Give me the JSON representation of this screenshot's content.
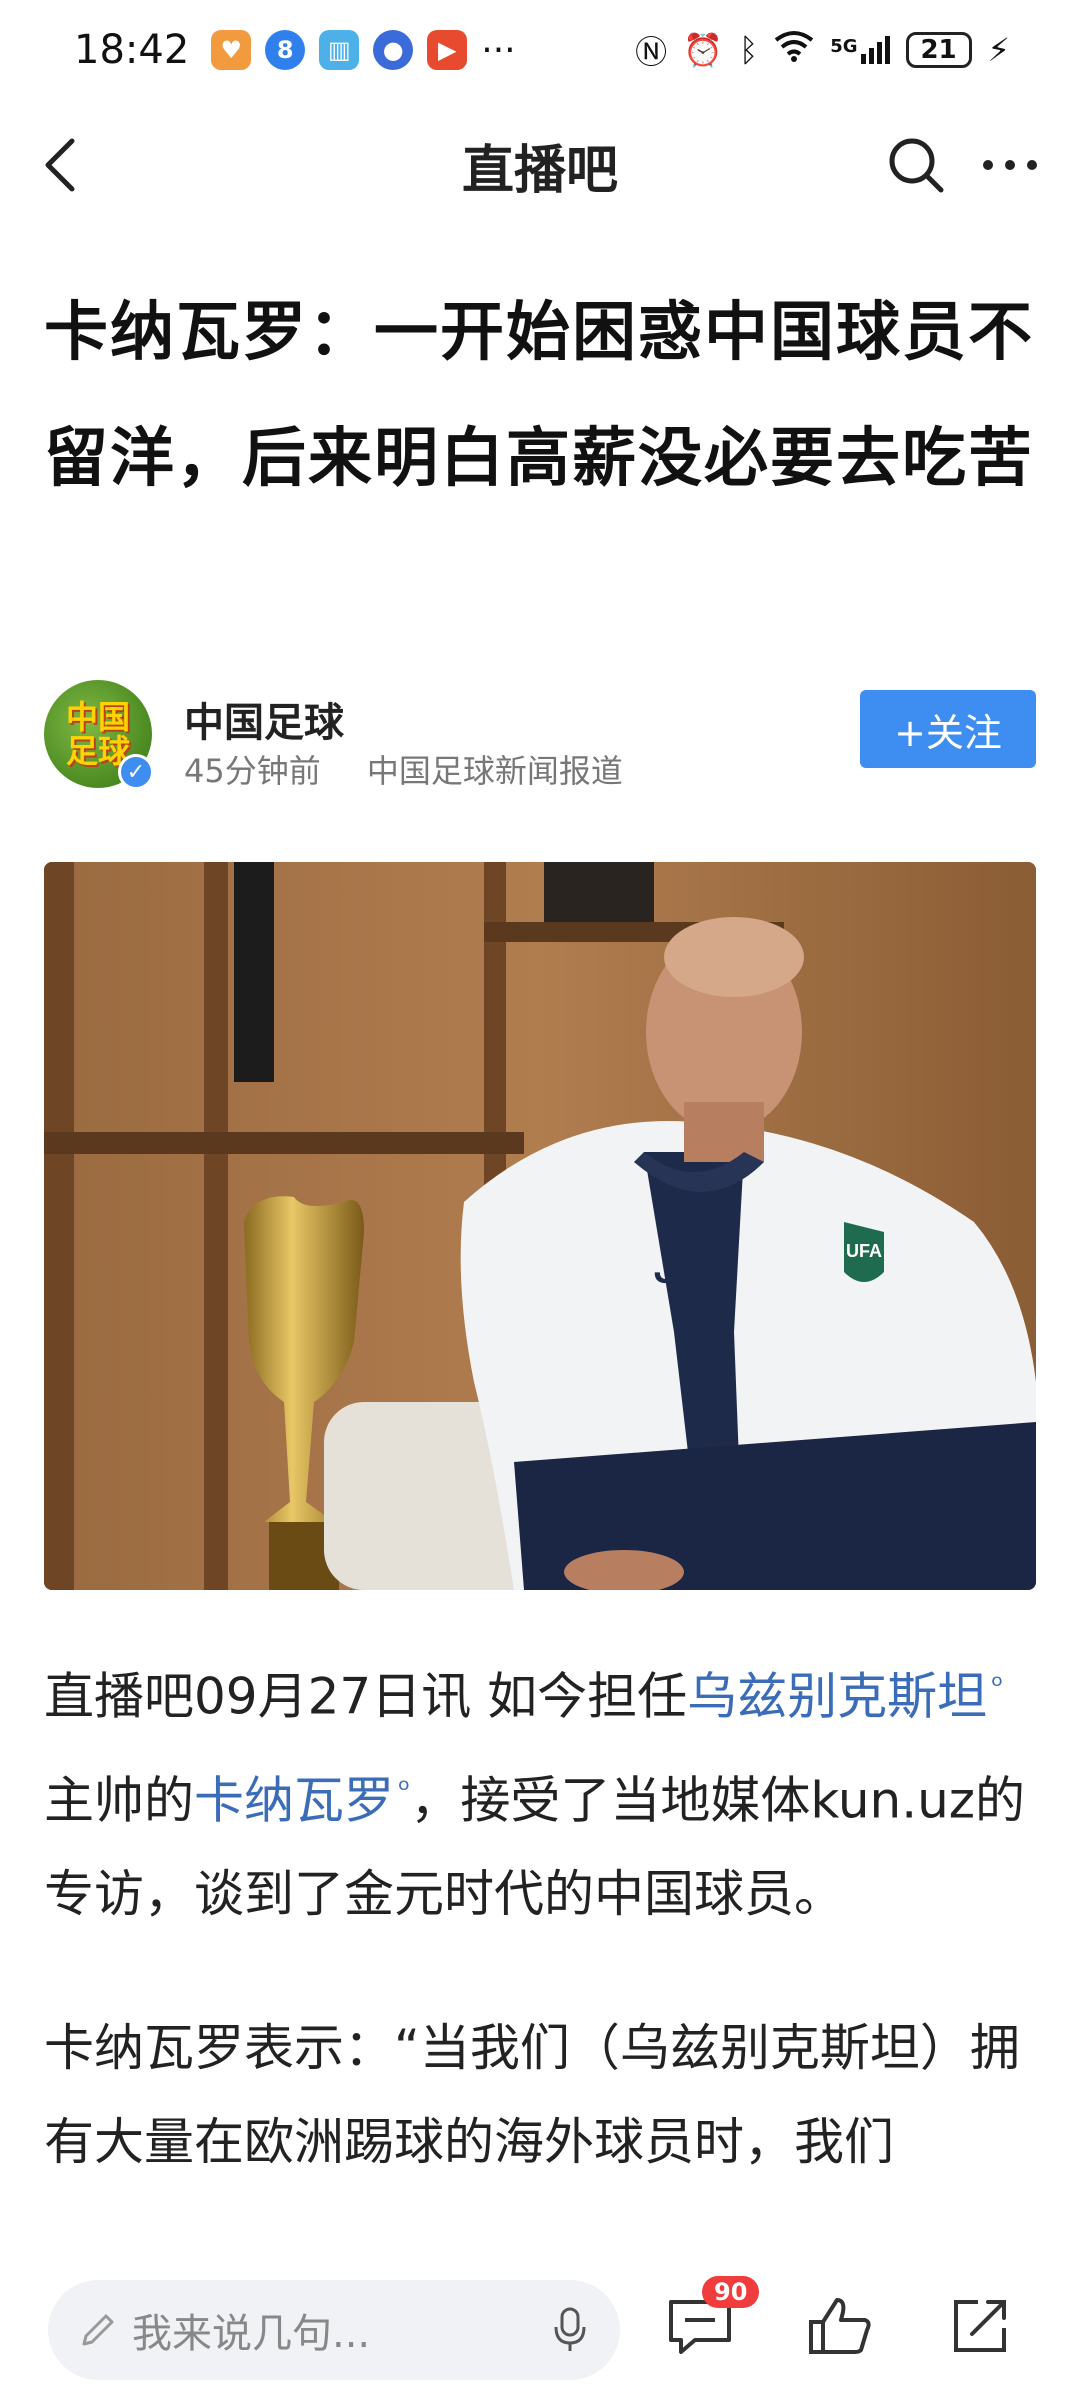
{
  "status_bar": {
    "time": "18:42",
    "battery": "21",
    "network": "5G",
    "more": "···"
  },
  "nav": {
    "title": "直播吧"
  },
  "article": {
    "headline": "卡纳瓦罗：一开始困惑中国球员不留洋，后来明白高薪没必要去吃苦",
    "author_name": "中国足球",
    "time_ago": "45分钟前",
    "source": "中国足球新闻报道",
    "follow_label": "+关注",
    "avatar_text": "中国足球",
    "p1_prefix": "直播吧09月27日讯 如今担任",
    "p1_link1": "乌兹别克斯坦",
    "p1_mid": " 主帅的",
    "p1_link2": "卡纳瓦罗",
    "p1_suffix": "，接受了当地媒体kun.uz的专访，谈到了金元时代的中国球员。",
    "p2": "卡纳瓦罗表示：“当我们（乌兹别克斯坦）拥有大量在欧洲踢球的海外球员时，我们"
  },
  "bottom_bar": {
    "comment_placeholder": "我来说几句...",
    "comment_count": "90"
  },
  "colors": {
    "accent": "#3d8ef0",
    "link": "#3a6cb8",
    "badge": "#f03c3c"
  }
}
